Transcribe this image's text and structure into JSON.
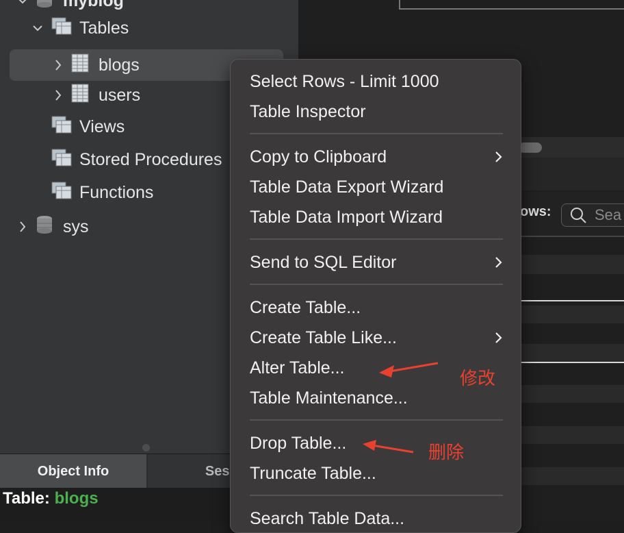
{
  "sidebar": {
    "schema_name": "myblog",
    "tables_label": "Tables",
    "tables": [
      "blogs",
      "users"
    ],
    "views_label": "Views",
    "procedures_label": "Stored Procedures",
    "functions_label": "Functions",
    "other_schema": "sys"
  },
  "tabs": {
    "object_info": "Object Info",
    "session": "Sessi"
  },
  "info": {
    "label": "Table:",
    "value": "blogs"
  },
  "right_panel": {
    "rows_label": "ows:",
    "search_placeholder": "Sea"
  },
  "menu": {
    "select_rows": "Select Rows - Limit 1000",
    "table_inspector": "Table Inspector",
    "copy_to_clipboard": "Copy to Clipboard",
    "export_wizard": "Table Data Export Wizard",
    "import_wizard": "Table Data Import Wizard",
    "send_to_sql": "Send to SQL Editor",
    "create_table": "Create Table...",
    "create_table_like": "Create Table Like...",
    "alter_table": "Alter Table...",
    "table_maintenance": "Table Maintenance...",
    "drop_table": "Drop Table...",
    "truncate_table": "Truncate Table...",
    "search_table_data": "Search Table Data..."
  },
  "annotations": {
    "alter_note": "修改",
    "drop_note": "删除",
    "color": "#e8412f"
  }
}
